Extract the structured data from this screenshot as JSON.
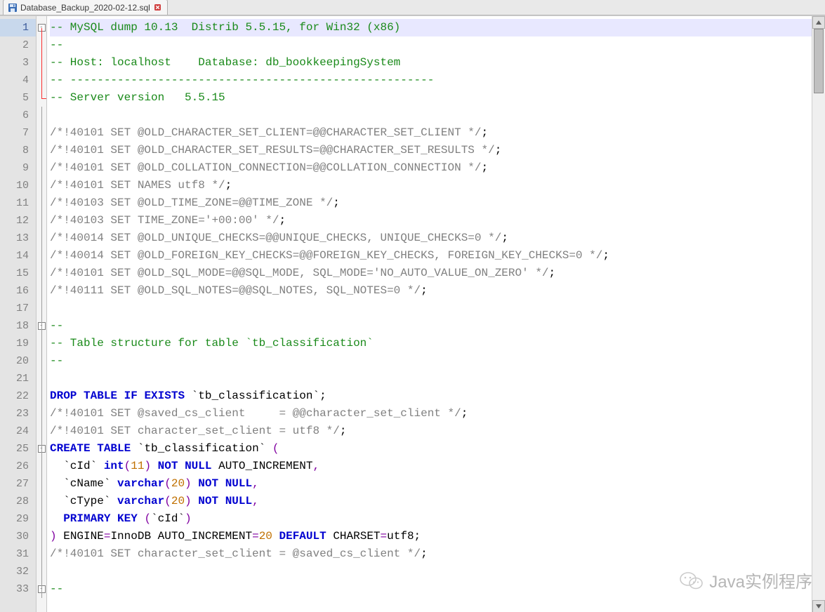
{
  "tab": {
    "filename": "Database_Backup_2020-02-12.sql"
  },
  "gutter": {
    "highlighted": 1,
    "count": 33
  },
  "fold": {
    "boxes": {
      "1": "-",
      "18": "-",
      "25": "-",
      "33": "-"
    },
    "redRange": [
      1,
      5
    ]
  },
  "code": {
    "lines": [
      {
        "n": 1,
        "hl": true,
        "segs": [
          {
            "cls": "c-comment",
            "t": "-- MySQL dump 10.13  Distrib 5.5.15, for Win32 (x86)"
          }
        ]
      },
      {
        "n": 2,
        "segs": [
          {
            "cls": "c-comment",
            "t": "--"
          }
        ]
      },
      {
        "n": 3,
        "segs": [
          {
            "cls": "c-comment",
            "t": "-- Host: localhost    Database: db_bookkeepingSystem"
          }
        ]
      },
      {
        "n": 4,
        "segs": [
          {
            "cls": "c-comment",
            "t": "-- ------------------------------------------------------"
          }
        ]
      },
      {
        "n": 5,
        "segs": [
          {
            "cls": "c-comment",
            "t": "-- Server version   5.5.15"
          }
        ]
      },
      {
        "n": 6,
        "segs": []
      },
      {
        "n": 7,
        "segs": [
          {
            "cls": "c-gray",
            "t": "/*!40101 SET @OLD_CHARACTER_SET_CLIENT=@@CHARACTER_SET_CLIENT */"
          },
          {
            "cls": "",
            "t": ";"
          }
        ]
      },
      {
        "n": 8,
        "segs": [
          {
            "cls": "c-gray",
            "t": "/*!40101 SET @OLD_CHARACTER_SET_RESULTS=@@CHARACTER_SET_RESULTS */"
          },
          {
            "cls": "",
            "t": ";"
          }
        ]
      },
      {
        "n": 9,
        "segs": [
          {
            "cls": "c-gray",
            "t": "/*!40101 SET @OLD_COLLATION_CONNECTION=@@COLLATION_CONNECTION */"
          },
          {
            "cls": "",
            "t": ";"
          }
        ]
      },
      {
        "n": 10,
        "segs": [
          {
            "cls": "c-gray",
            "t": "/*!40101 SET NAMES utf8 */"
          },
          {
            "cls": "",
            "t": ";"
          }
        ]
      },
      {
        "n": 11,
        "segs": [
          {
            "cls": "c-gray",
            "t": "/*!40103 SET @OLD_TIME_ZONE=@@TIME_ZONE */"
          },
          {
            "cls": "",
            "t": ";"
          }
        ]
      },
      {
        "n": 12,
        "segs": [
          {
            "cls": "c-gray",
            "t": "/*!40103 SET TIME_ZONE='+00:00' */"
          },
          {
            "cls": "",
            "t": ";"
          }
        ]
      },
      {
        "n": 13,
        "segs": [
          {
            "cls": "c-gray",
            "t": "/*!40014 SET @OLD_UNIQUE_CHECKS=@@UNIQUE_CHECKS, UNIQUE_CHECKS=0 */"
          },
          {
            "cls": "",
            "t": ";"
          }
        ]
      },
      {
        "n": 14,
        "segs": [
          {
            "cls": "c-gray",
            "t": "/*!40014 SET @OLD_FOREIGN_KEY_CHECKS=@@FOREIGN_KEY_CHECKS, FOREIGN_KEY_CHECKS=0 */"
          },
          {
            "cls": "",
            "t": ";"
          }
        ]
      },
      {
        "n": 15,
        "segs": [
          {
            "cls": "c-gray",
            "t": "/*!40101 SET @OLD_SQL_MODE=@@SQL_MODE, SQL_MODE='NO_AUTO_VALUE_ON_ZERO' */"
          },
          {
            "cls": "",
            "t": ";"
          }
        ]
      },
      {
        "n": 16,
        "segs": [
          {
            "cls": "c-gray",
            "t": "/*!40111 SET @OLD_SQL_NOTES=@@SQL_NOTES, SQL_NOTES=0 */"
          },
          {
            "cls": "",
            "t": ";"
          }
        ]
      },
      {
        "n": 17,
        "segs": []
      },
      {
        "n": 18,
        "segs": [
          {
            "cls": "c-comment",
            "t": "--"
          }
        ]
      },
      {
        "n": 19,
        "segs": [
          {
            "cls": "c-comment",
            "t": "-- Table structure for table `tb_classification`"
          }
        ]
      },
      {
        "n": 20,
        "segs": [
          {
            "cls": "c-comment",
            "t": "--"
          }
        ]
      },
      {
        "n": 21,
        "segs": []
      },
      {
        "n": 22,
        "segs": [
          {
            "cls": "c-kw",
            "t": "DROP"
          },
          {
            "t": " "
          },
          {
            "cls": "c-kw",
            "t": "TABLE"
          },
          {
            "t": " "
          },
          {
            "cls": "c-kw",
            "t": "IF"
          },
          {
            "t": " "
          },
          {
            "cls": "c-kw",
            "t": "EXISTS"
          },
          {
            "t": " `tb_classification`;"
          }
        ]
      },
      {
        "n": 23,
        "segs": [
          {
            "cls": "c-gray",
            "t": "/*!40101 SET @saved_cs_client     = @@character_set_client */"
          },
          {
            "t": ";"
          }
        ]
      },
      {
        "n": 24,
        "segs": [
          {
            "cls": "c-gray",
            "t": "/*!40101 SET character_set_client = utf8 */"
          },
          {
            "t": ";"
          }
        ]
      },
      {
        "n": 25,
        "segs": [
          {
            "cls": "c-kw",
            "t": "CREATE"
          },
          {
            "t": " "
          },
          {
            "cls": "c-kw",
            "t": "TABLE"
          },
          {
            "t": " `tb_classification` "
          },
          {
            "cls": "c-dkw",
            "t": "("
          }
        ]
      },
      {
        "n": 26,
        "segs": [
          {
            "t": "  `cId` "
          },
          {
            "cls": "c-kw",
            "t": "int"
          },
          {
            "cls": "c-dkw",
            "t": "("
          },
          {
            "cls": "c-num",
            "t": "11"
          },
          {
            "cls": "c-dkw",
            "t": ")"
          },
          {
            "t": " "
          },
          {
            "cls": "c-kw",
            "t": "NOT"
          },
          {
            "t": " "
          },
          {
            "cls": "c-kw",
            "t": "NULL"
          },
          {
            "t": " AUTO_INCREMENT"
          },
          {
            "cls": "c-dkw",
            "t": ","
          }
        ]
      },
      {
        "n": 27,
        "segs": [
          {
            "t": "  `cName` "
          },
          {
            "cls": "c-kw",
            "t": "varchar"
          },
          {
            "cls": "c-dkw",
            "t": "("
          },
          {
            "cls": "c-num",
            "t": "20"
          },
          {
            "cls": "c-dkw",
            "t": ")"
          },
          {
            "t": " "
          },
          {
            "cls": "c-kw",
            "t": "NOT"
          },
          {
            "t": " "
          },
          {
            "cls": "c-kw",
            "t": "NULL"
          },
          {
            "cls": "c-dkw",
            "t": ","
          }
        ]
      },
      {
        "n": 28,
        "segs": [
          {
            "t": "  `cType` "
          },
          {
            "cls": "c-kw",
            "t": "varchar"
          },
          {
            "cls": "c-dkw",
            "t": "("
          },
          {
            "cls": "c-num",
            "t": "20"
          },
          {
            "cls": "c-dkw",
            "t": ")"
          },
          {
            "t": " "
          },
          {
            "cls": "c-kw",
            "t": "NOT"
          },
          {
            "t": " "
          },
          {
            "cls": "c-kw",
            "t": "NULL"
          },
          {
            "cls": "c-dkw",
            "t": ","
          }
        ]
      },
      {
        "n": 29,
        "segs": [
          {
            "t": "  "
          },
          {
            "cls": "c-kw",
            "t": "PRIMARY"
          },
          {
            "t": " "
          },
          {
            "cls": "c-kw",
            "t": "KEY"
          },
          {
            "t": " "
          },
          {
            "cls": "c-dkw",
            "t": "("
          },
          {
            "t": "`cId`"
          },
          {
            "cls": "c-dkw",
            "t": ")"
          }
        ]
      },
      {
        "n": 30,
        "segs": [
          {
            "cls": "c-dkw",
            "t": ")"
          },
          {
            "t": " ENGINE"
          },
          {
            "cls": "c-dkw",
            "t": "="
          },
          {
            "t": "InnoDB AUTO_INCREMENT"
          },
          {
            "cls": "c-dkw",
            "t": "="
          },
          {
            "cls": "c-num",
            "t": "20"
          },
          {
            "t": " "
          },
          {
            "cls": "c-kw",
            "t": "DEFAULT"
          },
          {
            "t": " CHARSET"
          },
          {
            "cls": "c-dkw",
            "t": "="
          },
          {
            "t": "utf8;"
          }
        ]
      },
      {
        "n": 31,
        "segs": [
          {
            "cls": "c-gray",
            "t": "/*!40101 SET character_set_client = @saved_cs_client */"
          },
          {
            "t": ";"
          }
        ]
      },
      {
        "n": 32,
        "segs": []
      },
      {
        "n": 33,
        "segs": [
          {
            "cls": "c-comment",
            "t": "--"
          }
        ]
      }
    ]
  },
  "watermark": {
    "text": "Java实例程序"
  }
}
